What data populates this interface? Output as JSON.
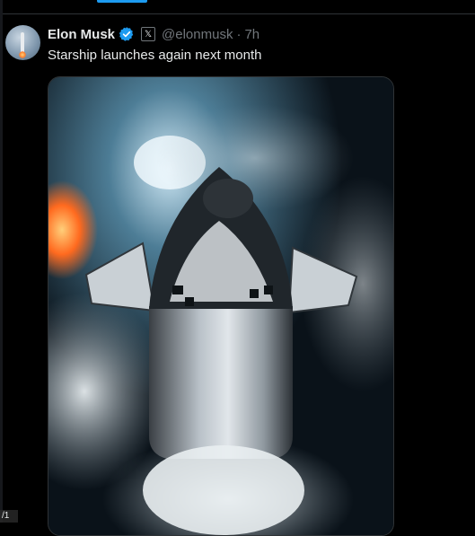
{
  "tweet": {
    "author_name": "Elon Musk",
    "handle": "@elonmusk",
    "separator": "·",
    "time": "7h",
    "text": "Starship launches again next month",
    "badge_glyph": "𝕏",
    "verified_icon": "verified-badge-icon",
    "media_alt_label": "",
    "media_counter": "/1"
  },
  "colors": {
    "accent": "#1d9bf0",
    "background": "#000000",
    "text_primary": "#e7e9ea",
    "text_secondary": "#71767b",
    "border": "#2f3336"
  }
}
